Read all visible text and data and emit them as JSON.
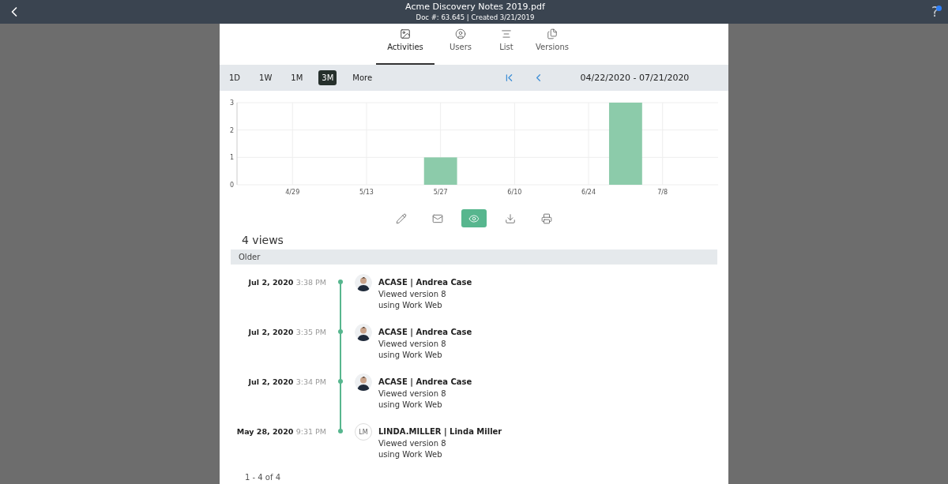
{
  "header": {
    "title": "Acme Discovery Notes 2019.pdf",
    "subtitle": "Doc #: 63.645 | Created 3/21/2019",
    "help": "?",
    "notification": true
  },
  "tabs": [
    {
      "label": "Activities",
      "kind": "image",
      "selected": true
    },
    {
      "label": "Users",
      "kind": "user",
      "selected": false
    },
    {
      "label": "List",
      "kind": "list",
      "selected": false
    },
    {
      "label": "Versions",
      "kind": "versions",
      "selected": false
    }
  ],
  "ranges": [
    {
      "label": "1D",
      "selected": false
    },
    {
      "label": "1W",
      "selected": false
    },
    {
      "label": "1M",
      "selected": false
    },
    {
      "label": "3M",
      "selected": true
    },
    {
      "label": "More",
      "selected": false
    }
  ],
  "date_range": "04/22/2020 - 07/21/2020",
  "chart_data": {
    "type": "bar",
    "categories": [
      null,
      "4/29",
      null,
      "5/13",
      null,
      "5/27",
      null,
      "6/10",
      null,
      "6/24",
      null,
      "7/8",
      null
    ],
    "series": [
      {
        "color": "#8ccbaa",
        "values": [
          0,
          0,
          0,
          0,
          0,
          1,
          0,
          0,
          0,
          0,
          3,
          0,
          0
        ]
      }
    ],
    "ylim": [
      0,
      3
    ],
    "yticks": [
      0,
      1,
      2,
      3
    ],
    "grid": true
  },
  "actions": [
    {
      "kind": "edit",
      "selected": false
    },
    {
      "kind": "mail",
      "selected": false
    },
    {
      "kind": "view",
      "selected": true
    },
    {
      "kind": "download",
      "selected": false
    },
    {
      "kind": "print",
      "selected": false
    }
  ],
  "count": "4 views",
  "group": "Older",
  "events": [
    {
      "date": "Jul 2, 2020",
      "time": "3:38 PM",
      "avatar": {
        "kind": "photo"
      },
      "user": "ACASE | Andrea Case",
      "action": "Viewed version 8",
      "via": "using Work Web"
    },
    {
      "date": "Jul 2, 2020",
      "time": "3:35 PM",
      "avatar": {
        "kind": "photo"
      },
      "user": "ACASE | Andrea Case",
      "action": "Viewed version 8",
      "via": "using Work Web"
    },
    {
      "date": "Jul 2, 2020",
      "time": "3:34 PM",
      "avatar": {
        "kind": "photo"
      },
      "user": "ACASE | Andrea Case",
      "action": "Viewed version 8",
      "via": "using Work Web"
    },
    {
      "date": "May 28, 2020",
      "time": "9:31 PM",
      "avatar": {
        "kind": "initials",
        "initials": "LM"
      },
      "user": "LINDA.MILLER | Linda Miller",
      "action": "Viewed version 8",
      "via": "using Work Web"
    }
  ],
  "pager": "1 - 4 of 4"
}
